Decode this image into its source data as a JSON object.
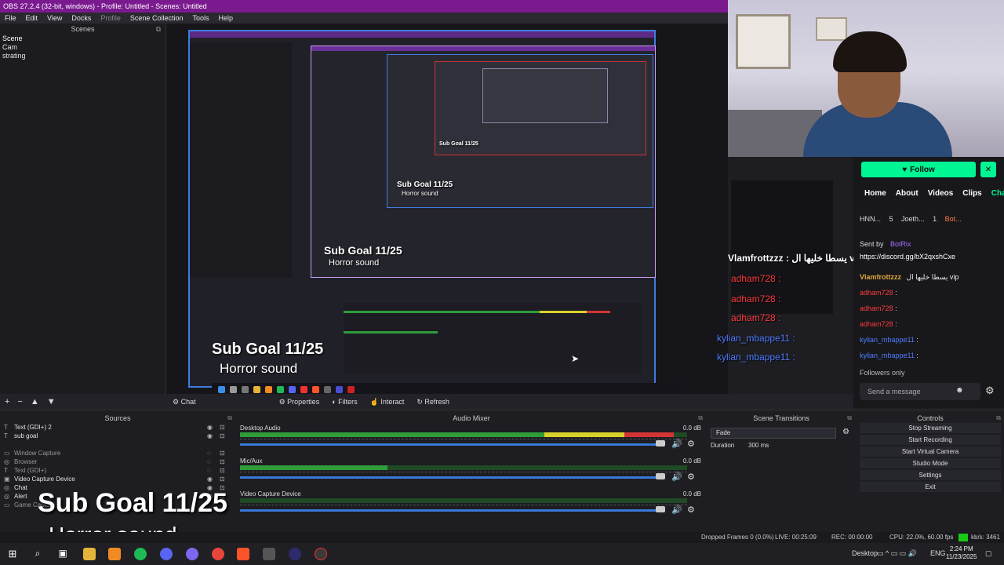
{
  "window": {
    "title": "OBS 27.2.4 (32-bit, windows) - Profile: Untitled - Scenes: Untitled"
  },
  "menu": [
    "File",
    "Edit",
    "View",
    "Docks",
    "Profile",
    "Scene Collection",
    "Tools",
    "Help"
  ],
  "scenes": {
    "header": "Scenes",
    "items": [
      "Scene",
      "Cam",
      "strating"
    ]
  },
  "preview_overlay": {
    "sub_goal": "Sub Goal 11/25",
    "horror": "Horror sound",
    "chat_lines": [
      {
        "user": "Vlamfrottzzz",
        "text": ": يسطا خليها ال vip",
        "color": "#ffffff"
      },
      {
        "user": "adham728",
        "text": ":",
        "color": "#ff3b3b"
      },
      {
        "user": "adham728",
        "text": ":",
        "color": "#ff3b3b"
      },
      {
        "user": "adham728",
        "text": ":",
        "color": "#ff3b3b"
      },
      {
        "user": "kylian_mbappe11",
        "text": ":",
        "color": "#4f7dff"
      },
      {
        "user": "kylian_mbappe11",
        "text": ":",
        "color": "#4f7dff"
      }
    ]
  },
  "channel": {
    "follow_label": "Follow",
    "tabs": [
      "Home",
      "About",
      "Videos",
      "Clips",
      "Chat"
    ],
    "active_tab": "Chat",
    "header_users": [
      "HNN...",
      "5",
      "Joeth...",
      "1",
      "Bot..."
    ],
    "sent_by": "Sent by",
    "bot_name": "BotRix",
    "link": "https://discord.gg/bX2qxshCxe",
    "chat": [
      {
        "user": "Vlamfrottzzz",
        "text": "يسطا خليها ال vip",
        "color": "#e0a93b"
      },
      {
        "user": "adham728",
        "text": ":",
        "color": "#ff3b3b"
      },
      {
        "user": "adham728",
        "text": ":",
        "color": "#ff3b3b"
      },
      {
        "user": "adham728",
        "text": ":",
        "color": "#ff3b3b"
      },
      {
        "user": "kylian_mbappe11",
        "text": ":",
        "color": "#4f7dff"
      },
      {
        "user": "kylian_mbappe11",
        "text": ":",
        "color": "#4f7dff"
      }
    ],
    "followers_only": "Followers only",
    "send_placeholder": "Send a message"
  },
  "toolbar": {
    "current_source": "Chat",
    "properties": "Properties",
    "filters": "Filters",
    "interact": "Interact",
    "refresh": "Refresh"
  },
  "sources": {
    "header": "Sources",
    "items": [
      {
        "icon": "T",
        "name": "Text (GDI+) 2"
      },
      {
        "icon": "T",
        "name": "sub goal"
      },
      {
        "icon": "",
        "name": ""
      },
      {
        "icon": "▭",
        "name": "Window Capture"
      },
      {
        "icon": "◎",
        "name": "Browser"
      },
      {
        "icon": "T",
        "name": "Text (GDI+)"
      },
      {
        "icon": "▣",
        "name": "Video Capture Device"
      },
      {
        "icon": "◎",
        "name": "Chat"
      },
      {
        "icon": "◎",
        "name": "Alert"
      },
      {
        "icon": "▭",
        "name": "Game Capture"
      }
    ]
  },
  "mixer": {
    "header": "Audio Mixer",
    "channels": [
      {
        "name": "Desktop Audio",
        "db": "0.0 dB",
        "level": 0.97
      },
      {
        "name": "Mic/Aux",
        "db": "0.0 dB",
        "level": 0.33
      },
      {
        "name": "Video Capture Device",
        "db": "0.0 dB",
        "level": 0.0
      }
    ]
  },
  "transitions": {
    "header": "Scene Transitions",
    "selected": "Fade",
    "duration_label": "Duration",
    "duration_value": "300 ms"
  },
  "controls": {
    "header": "Controls",
    "buttons": [
      "Stop Streaming",
      "Start Recording",
      "Start Virtual Camera",
      "Studio Mode",
      "Settings",
      "Exit"
    ]
  },
  "overlay": {
    "sub_goal": "Sub Goal 11/25",
    "horror": "Horror sound"
  },
  "status": {
    "dropped": "Dropped Frames 0 (0.0%)",
    "live": "LIVE: 00:25:09",
    "rec": "REC: 00:00:00",
    "cpu": "CPU: 22.0%, 60.00 fps",
    "kbps": "kb/s: 3461"
  },
  "tray": {
    "desktop": "Desktop",
    "lang": "ENG",
    "time": "2:24 PM",
    "date": "11/23/2025"
  },
  "colors": {
    "obs_title": "#7a1a8f",
    "twitch_green": "#00f593",
    "meter_green": "#2e9d3a",
    "meter_yellow": "#d8d02b",
    "meter_red": "#d33434"
  }
}
